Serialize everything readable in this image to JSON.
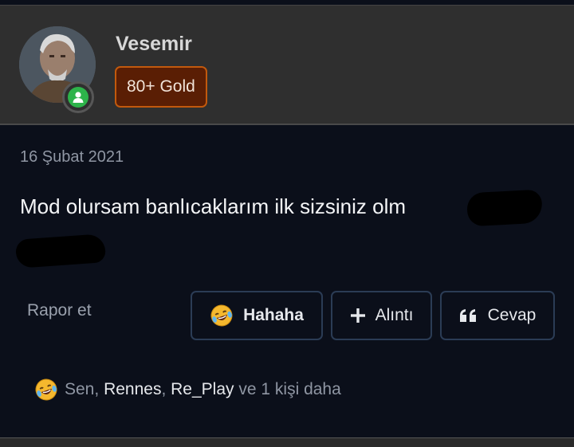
{
  "post": {
    "author": {
      "name": "Vesemir",
      "badge": "80+ Gold",
      "status_color": "#2db34a"
    },
    "date": "16 Şubat 2021",
    "message": "Mod olursam banlıcaklarım ilk sizsiniz olm",
    "report_label": "Rapor et",
    "actions": {
      "haha": "Hahaha",
      "quote": "Alıntı",
      "reply": "Cevap"
    },
    "reactions": {
      "you": "Sen",
      "sep1": ",",
      "user1": "Rennes",
      "sep2": ",",
      "user2": "Re_Play",
      "suffix": "ve 1 kişi daha"
    },
    "colors": {
      "background": "#0b0f1a",
      "header": "#2f2f2f",
      "badge_bg": "#5a1e04",
      "badge_border": "#c2590d",
      "button_border": "#2b3c55"
    },
    "icons": [
      "laughing-emoji-icon",
      "plus-icon",
      "quote-icon",
      "online-status-icon"
    ]
  }
}
